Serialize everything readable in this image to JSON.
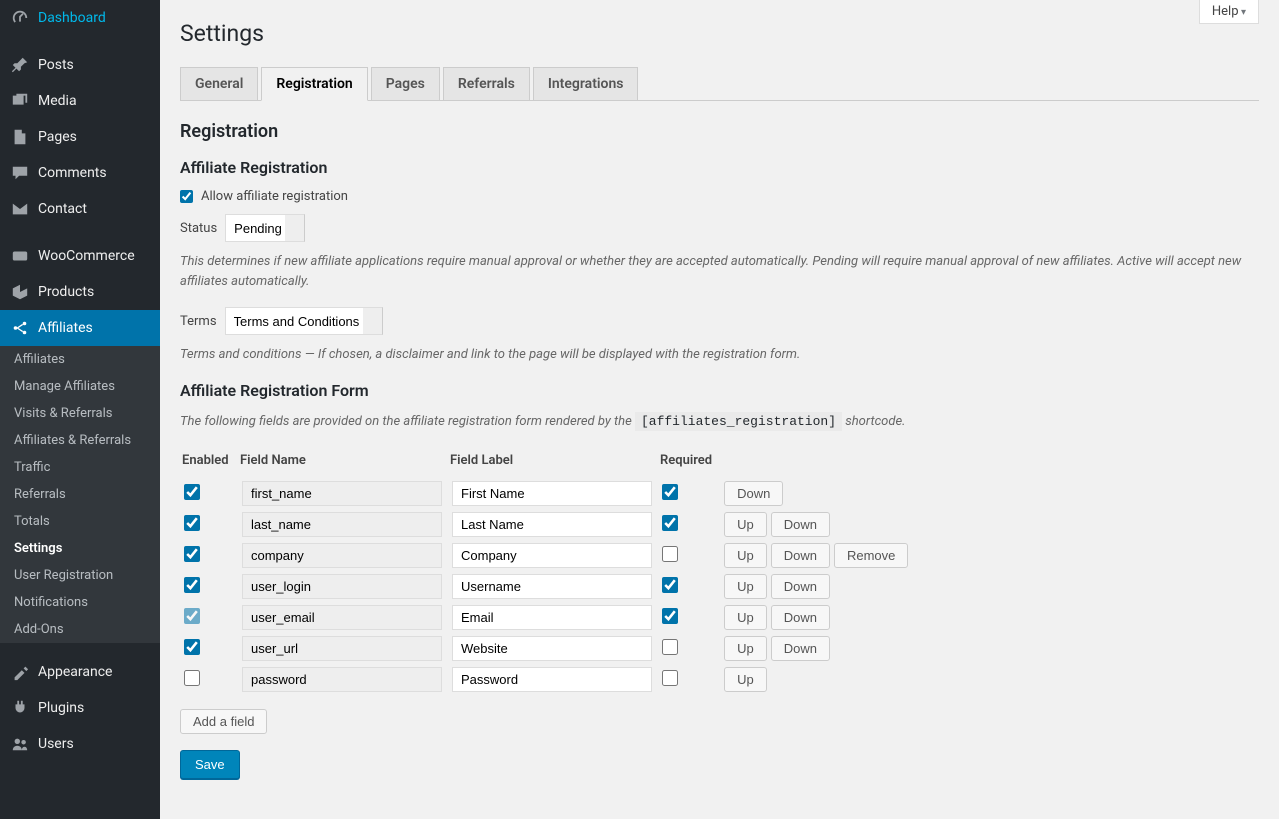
{
  "sidebar": {
    "items": [
      {
        "label": "Dashboard",
        "icon": "dashboard"
      },
      {
        "sep": true
      },
      {
        "label": "Posts",
        "icon": "pin"
      },
      {
        "label": "Media",
        "icon": "media"
      },
      {
        "label": "Pages",
        "icon": "page"
      },
      {
        "label": "Comments",
        "icon": "comment"
      },
      {
        "label": "Contact",
        "icon": "mail"
      },
      {
        "sep": true
      },
      {
        "label": "WooCommerce",
        "icon": "woo"
      },
      {
        "label": "Products",
        "icon": "product"
      },
      {
        "label": "Affiliates",
        "icon": "affiliate",
        "current": true,
        "submenu": [
          {
            "label": "Affiliates"
          },
          {
            "label": "Manage Affiliates"
          },
          {
            "label": "Visits & Referrals"
          },
          {
            "label": "Affiliates & Referrals"
          },
          {
            "label": "Traffic"
          },
          {
            "label": "Referrals"
          },
          {
            "label": "Totals"
          },
          {
            "label": "Settings",
            "current": true
          },
          {
            "label": "User Registration"
          },
          {
            "label": "Notifications"
          },
          {
            "label": "Add-Ons"
          }
        ]
      },
      {
        "sep": true
      },
      {
        "label": "Appearance",
        "icon": "appearance"
      },
      {
        "label": "Plugins",
        "icon": "plugin"
      },
      {
        "label": "Users",
        "icon": "users"
      }
    ]
  },
  "help_label": "Help",
  "page_title": "Settings",
  "tabs": [
    {
      "label": "General"
    },
    {
      "label": "Registration",
      "active": true
    },
    {
      "label": "Pages"
    },
    {
      "label": "Referrals"
    },
    {
      "label": "Integrations"
    }
  ],
  "section_registration": "Registration",
  "subsection_affiliate_reg": "Affiliate Registration",
  "allow_reg_label": "Allow affiliate registration",
  "allow_reg_checked": true,
  "status_label": "Status",
  "status_value": "Pending",
  "status_description": "This determines if new affiliate applications require manual approval or whether they are accepted automatically. Pending will require manual approval of new affiliates. Active will accept new affiliates automatically.",
  "terms_label": "Terms",
  "terms_value": "Terms and Conditions",
  "terms_description": "Terms and conditions — If chosen, a disclaimer and link to the page will be displayed with the registration form.",
  "subsection_form": "Affiliate Registration Form",
  "form_description_prefix": "The following fields are provided on the affiliate registration form rendered by the ",
  "form_shortcode": "[affiliates_registration]",
  "form_description_suffix": " shortcode.",
  "table_headers": {
    "enabled": "Enabled",
    "field_name": "Field Name",
    "field_label": "Field Label",
    "required": "Required"
  },
  "fields": [
    {
      "enabled": true,
      "name": "first_name",
      "label": "First Name",
      "required": true,
      "buttons": [
        "Down"
      ]
    },
    {
      "enabled": true,
      "name": "last_name",
      "label": "Last Name",
      "required": true,
      "buttons": [
        "Up",
        "Down"
      ]
    },
    {
      "enabled": true,
      "name": "company",
      "label": "Company",
      "required": false,
      "buttons": [
        "Up",
        "Down",
        "Remove"
      ]
    },
    {
      "enabled": true,
      "name": "user_login",
      "label": "Username",
      "required": true,
      "buttons": [
        "Up",
        "Down"
      ]
    },
    {
      "enabled": true,
      "name": "user_email",
      "label": "Email",
      "required": true,
      "buttons": [
        "Up",
        "Down"
      ],
      "enabled_locked": true
    },
    {
      "enabled": true,
      "name": "user_url",
      "label": "Website",
      "required": false,
      "buttons": [
        "Up",
        "Down"
      ]
    },
    {
      "enabled": false,
      "name": "password",
      "label": "Password",
      "required": false,
      "buttons": [
        "Up"
      ]
    }
  ],
  "add_field_label": "Add a field",
  "save_label": "Save"
}
